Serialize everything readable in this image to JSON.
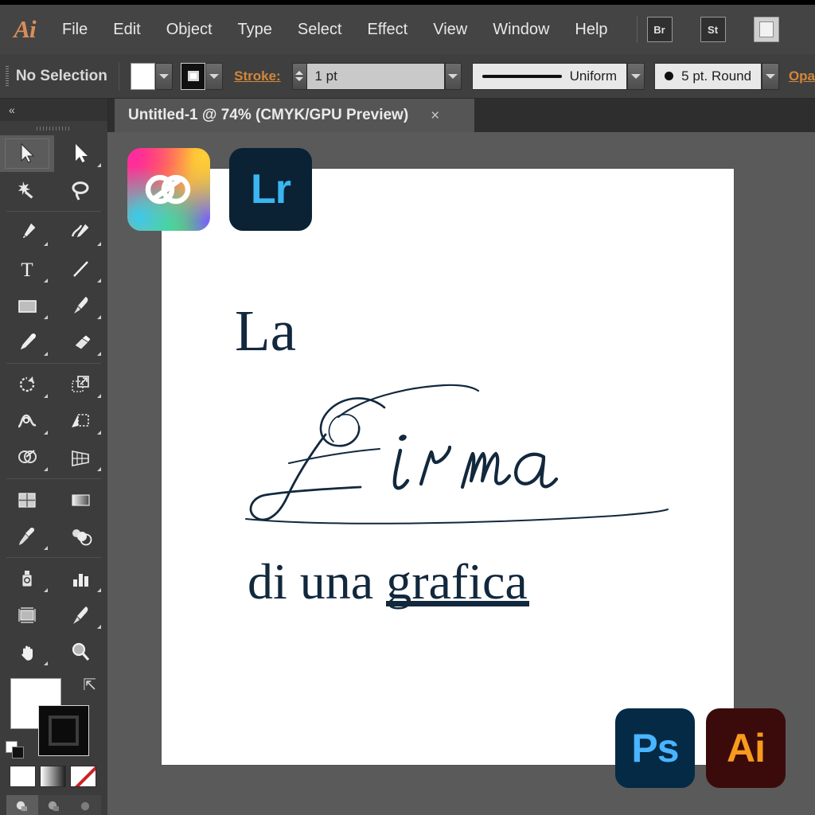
{
  "app": {
    "name": "Adobe Illustrator",
    "logo_text": "Ai"
  },
  "menubar": {
    "items": [
      {
        "label": "File"
      },
      {
        "label": "Edit"
      },
      {
        "label": "Object"
      },
      {
        "label": "Type"
      },
      {
        "label": "Select"
      },
      {
        "label": "Effect"
      },
      {
        "label": "View"
      },
      {
        "label": "Window"
      },
      {
        "label": "Help"
      }
    ],
    "app_buttons": [
      {
        "label": "Br",
        "name": "bridge-button"
      },
      {
        "label": "St",
        "name": "stock-button"
      }
    ]
  },
  "controlbar": {
    "selection_status": "No Selection",
    "stroke_label": "Stroke:",
    "stroke_weight": "1 pt",
    "profile_value": "Uniform",
    "brush_value": "5 pt. Round",
    "opacity_label": "Opa",
    "fill_color": "#ffffff",
    "stroke_color": "#111111",
    "link_color": "#d2873a"
  },
  "tab": {
    "title": "Untitled-1 @ 74% (CMYK/GPU Preview)",
    "close_glyph": "×",
    "zoom": "74%",
    "color_mode": "CMYK",
    "preview_mode": "GPU Preview",
    "document_name": "Untitled-1"
  },
  "toolbar": {
    "collapse_glyph": "«",
    "tools": [
      {
        "name": "selection-tool",
        "active": true
      },
      {
        "name": "direct-selection-tool",
        "active": false
      },
      {
        "name": "magic-wand-tool",
        "active": false
      },
      {
        "name": "lasso-tool",
        "active": false
      },
      {
        "name": "pen-tool",
        "active": false
      },
      {
        "name": "curvature-tool",
        "active": false
      },
      {
        "name": "type-tool",
        "active": false
      },
      {
        "name": "line-segment-tool",
        "active": false
      },
      {
        "name": "rectangle-tool",
        "active": false
      },
      {
        "name": "paintbrush-tool",
        "active": false
      },
      {
        "name": "pencil-tool",
        "active": false
      },
      {
        "name": "eraser-tool",
        "active": false
      },
      {
        "name": "rotate-tool",
        "active": false
      },
      {
        "name": "scale-tool",
        "active": false
      },
      {
        "name": "width-tool",
        "active": false
      },
      {
        "name": "free-transform-tool",
        "active": false
      },
      {
        "name": "shape-builder-tool",
        "active": false
      },
      {
        "name": "perspective-grid-tool",
        "active": false
      },
      {
        "name": "mesh-tool",
        "active": false
      },
      {
        "name": "gradient-tool",
        "active": false
      },
      {
        "name": "eyedropper-tool",
        "active": false
      },
      {
        "name": "blend-tool",
        "active": false
      },
      {
        "name": "symbol-sprayer-tool",
        "active": false
      },
      {
        "name": "column-graph-tool",
        "active": false
      },
      {
        "name": "artboard-tool",
        "active": false
      },
      {
        "name": "slice-tool",
        "active": false
      },
      {
        "name": "hand-tool",
        "active": false
      },
      {
        "name": "zoom-tool",
        "active": false
      }
    ],
    "fill_color": "#ffffff",
    "stroke_color": "#0c0c0c",
    "color_modes": [
      {
        "name": "color-mode-solid",
        "label": "Color"
      },
      {
        "name": "color-mode-gradient",
        "label": "Gradient"
      },
      {
        "name": "color-mode-none",
        "label": "None"
      }
    ],
    "draw_modes": [
      {
        "name": "draw-normal-mode",
        "selected": true
      },
      {
        "name": "draw-behind-mode",
        "selected": false
      },
      {
        "name": "draw-inside-mode",
        "selected": false
      }
    ]
  },
  "canvas": {
    "background_color": "#5a5a5a",
    "artboard_color": "#ffffff"
  },
  "artwork": {
    "ink_color": "#12283d",
    "line1": "La",
    "line2": "Firma",
    "line3_prefix": "di una ",
    "line3_underlined": "grafica",
    "line3_full": "di una grafica"
  },
  "floating_icons": [
    {
      "name": "creative-cloud-icon",
      "label": "",
      "bg": "gradient",
      "fg": "#ffffff"
    },
    {
      "name": "lightroom-icon",
      "label": "Lr",
      "bg": "#0a2233",
      "fg": "#3ab6f0"
    },
    {
      "name": "photoshop-icon",
      "label": "Ps",
      "bg": "#042a45",
      "fg": "#49b4ff"
    },
    {
      "name": "illustrator-icon",
      "label": "Ai",
      "bg": "#3b0b0b",
      "fg": "#f79a1e"
    }
  ]
}
